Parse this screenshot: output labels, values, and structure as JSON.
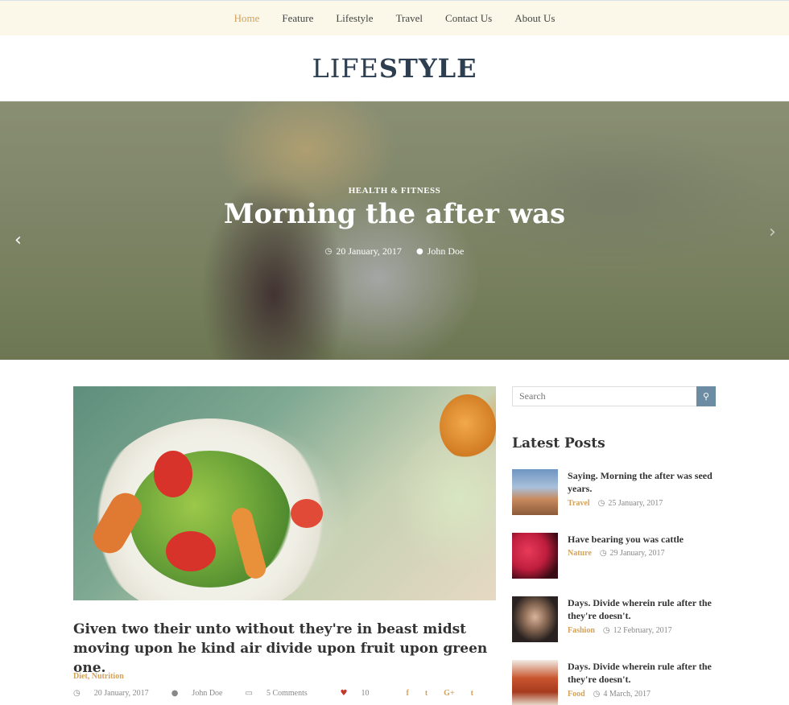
{
  "nav": {
    "items": [
      {
        "label": "Home",
        "active": true
      },
      {
        "label": "Feature",
        "active": false
      },
      {
        "label": "Lifestyle",
        "active": false
      },
      {
        "label": "Travel",
        "active": false
      },
      {
        "label": "Contact Us",
        "active": false
      },
      {
        "label": "About Us",
        "active": false
      }
    ]
  },
  "logo": {
    "part1": "LIFE",
    "part2": "STYLE"
  },
  "hero": {
    "category": "HEALTH & FITNESS",
    "title": "Morning the after was",
    "date": "20 January, 2017",
    "author": "John Doe",
    "prev_icon": "chevron-left-icon",
    "next_icon": "chevron-right-icon"
  },
  "article": {
    "title": "Given two their unto without they're in beast midst moving upon he kind air divide upon fruit upon green one.",
    "categories": "Diet, Nutrition",
    "date": "20 January, 2017",
    "author": "John Doe",
    "comments": "5 Comments",
    "likes": "10",
    "share": [
      "f",
      "t",
      "G+",
      "t"
    ]
  },
  "sidebar": {
    "search_placeholder": "Search",
    "latest_heading": "Latest Posts",
    "posts": [
      {
        "title": "Saying. Morning the after was seed years.",
        "category": "Travel",
        "date": "25 January, 2017"
      },
      {
        "title": "Have bearing you was cattle",
        "category": "Nature",
        "date": "29 January, 2017"
      },
      {
        "title": "Days. Divide wherein rule after the they're doesn't.",
        "category": "Fashion",
        "date": "12 February, 2017"
      },
      {
        "title": "Days. Divide wherein rule after the they're doesn't.",
        "category": "Food",
        "date": "4 March, 2017"
      }
    ]
  },
  "colors": {
    "accent": "#d4a25a",
    "nav_bg": "#fbf8e9",
    "heading": "#2c3e50",
    "search_btn": "#6b8ca3"
  }
}
